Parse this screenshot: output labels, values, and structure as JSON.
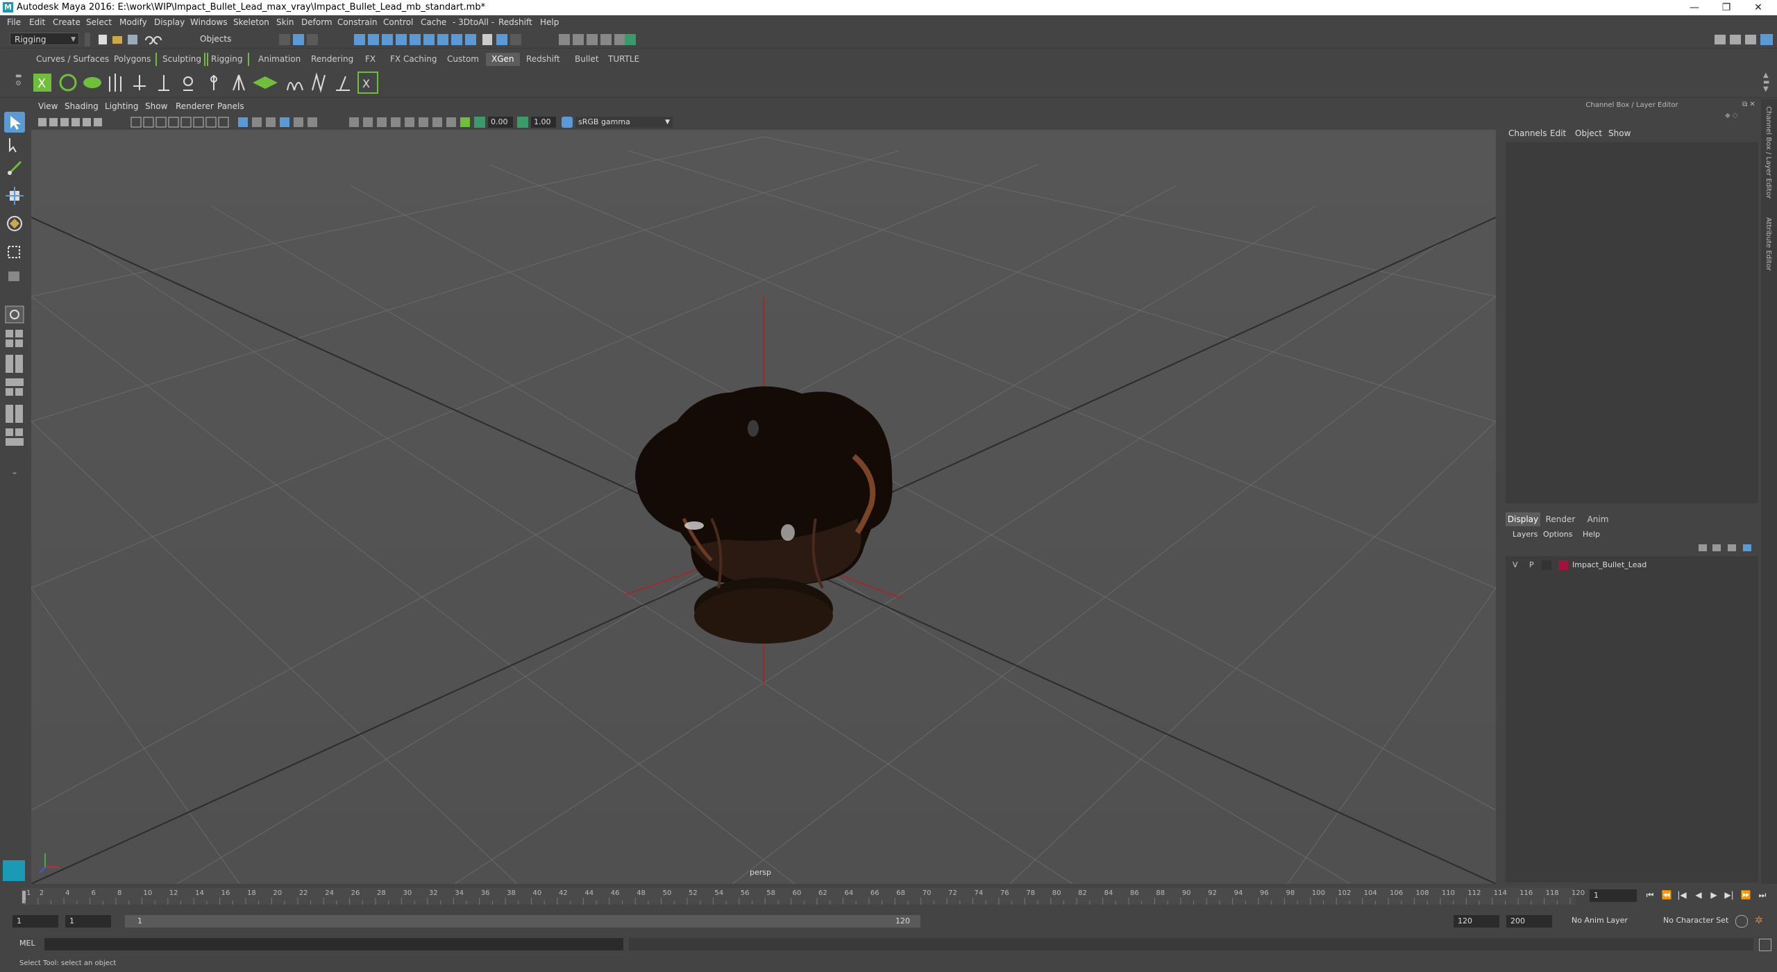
{
  "window": {
    "title": "Autodesk Maya 2016: E:\\work\\WIP\\Impact_Bullet_Lead_max_vray\\Impact_Bullet_Lead_mb_standart.mb*",
    "logo": "M",
    "minimize": "—",
    "restore": "❐",
    "close": "✕"
  },
  "menubar": [
    "File",
    "Edit",
    "Create",
    "Select",
    "Modify",
    "Display",
    "Windows",
    "Skeleton",
    "Skin",
    "Deform",
    "Constrain",
    "Control",
    "Cache",
    "- 3DtoAll -",
    "Redshift",
    "Help"
  ],
  "statusline": {
    "menuset": "Rigging",
    "selection_mode": "Objects"
  },
  "shelf_tabs": [
    {
      "label": "Curves / Surfaces",
      "active": false
    },
    {
      "label": "Polygons",
      "active": false
    },
    {
      "label": "Sculpting",
      "active": false
    },
    {
      "label": "Rigging",
      "active": false
    },
    {
      "label": "Animation",
      "active": false
    },
    {
      "label": "Rendering",
      "active": false
    },
    {
      "label": "FX",
      "active": false
    },
    {
      "label": "FX Caching",
      "active": false
    },
    {
      "label": "Custom",
      "active": false
    },
    {
      "label": "XGen",
      "active": true
    },
    {
      "label": "Redshift",
      "active": false
    },
    {
      "label": "Bullet",
      "active": false
    },
    {
      "label": "TURTLE",
      "active": false
    }
  ],
  "viewport": {
    "menu": [
      "View",
      "Shading",
      "Lighting",
      "Show",
      "Renderer",
      "Panels"
    ],
    "exposure": "0.00",
    "gamma": "1.00",
    "color_space": "sRGB gamma",
    "camera_label": "persp"
  },
  "channel_box": {
    "title": "Channel Box / Layer Editor",
    "menu": [
      "Channels",
      "Edit",
      "Object",
      "Show"
    ]
  },
  "layer_editor": {
    "tabs": [
      {
        "label": "Display",
        "active": true
      },
      {
        "label": "Render",
        "active": false
      },
      {
        "label": "Anim",
        "active": false
      }
    ],
    "menu": [
      "Layers",
      "Options",
      "Help"
    ],
    "layers": [
      {
        "v": "V",
        "p": "P",
        "name": "Impact_Bullet_Lead",
        "color": "#a0143c"
      }
    ]
  },
  "side_tabs": [
    "Channel Box / Layer Editor",
    "Attribute Editor"
  ],
  "timeline": {
    "start": 1,
    "end": 120,
    "ticks": [
      "1",
      "2",
      "4",
      "6",
      "8",
      "10",
      "12",
      "14",
      "16",
      "18",
      "20",
      "22",
      "24",
      "26",
      "28",
      "30",
      "32",
      "34",
      "36",
      "38",
      "40",
      "42",
      "44",
      "46",
      "48",
      "50",
      "52",
      "54",
      "56",
      "58",
      "60",
      "62",
      "64",
      "66",
      "68",
      "70",
      "72",
      "74",
      "76",
      "78",
      "80",
      "82",
      "84",
      "86",
      "88",
      "90",
      "92",
      "94",
      "96",
      "98",
      "100",
      "102",
      "104",
      "106",
      "108",
      "110",
      "112",
      "114",
      "116",
      "118",
      "120"
    ],
    "current_frame": "1"
  },
  "range": {
    "start_field": "1",
    "start_field2": "1",
    "slider_start": "1",
    "slider_end": "120",
    "end_field": "120",
    "end_field2": "200",
    "anim_layer": "No Anim Layer",
    "character_set": "No Character Set"
  },
  "command_line": {
    "label": "MEL"
  },
  "help_line": "Select Tool: select an object",
  "colors": {
    "accent": "#5c9ad6",
    "shelf_green": "#6fbf3a",
    "layer_color": "#a0143c"
  }
}
